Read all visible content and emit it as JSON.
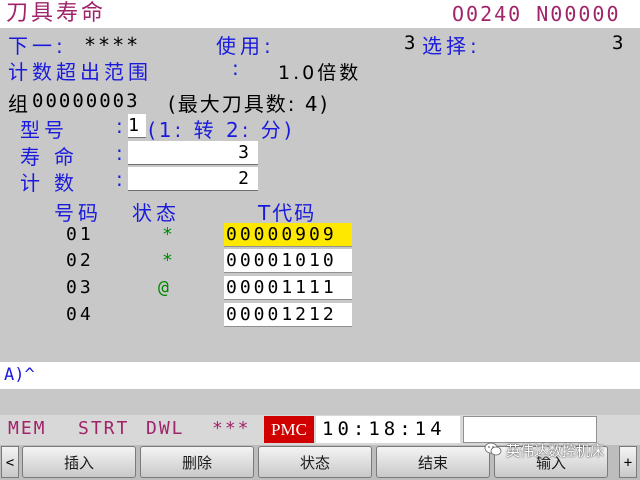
{
  "header": {
    "title": "刀具寿命",
    "program": "O0240 N00000"
  },
  "info": {
    "next_label": "下一:",
    "next_value": "****",
    "use_label": "使用:",
    "use_value": "3",
    "select_label": "选择:",
    "select_value": "3",
    "overflow_label": "计数超出范围",
    "overflow_colon": ":",
    "overflow_value": "1.0倍数"
  },
  "group": {
    "label": "组",
    "number": "00000003",
    "max_tools": "(最大刀具数:  4)"
  },
  "fields": {
    "type_label": "型号",
    "type_colon": ":",
    "type_value": "1",
    "type_hint": "(1: 转 2: 分)",
    "life_label": "寿命",
    "life_colon": ":",
    "life_value": "3",
    "count_label": "计数",
    "count_colon": ":",
    "count_value": "2"
  },
  "table": {
    "headers": {
      "num": "号码",
      "status": "状态",
      "tcode": "T代码"
    },
    "rows": [
      {
        "num": "01",
        "status": "*",
        "tcode": "00000909"
      },
      {
        "num": "02",
        "status": "*",
        "tcode": "00001010"
      },
      {
        "num": "03",
        "status": "@",
        "tcode": "00001111"
      },
      {
        "num": "04",
        "status": "",
        "tcode": "00001212"
      }
    ]
  },
  "input": {
    "prompt": "A)^"
  },
  "status": {
    "mode": "MEM",
    "run": "STRT",
    "motion": "DWL",
    "alarm": "***",
    "pmc": "PMC",
    "time": "10:18:14"
  },
  "softkeys": {
    "left_arrow": "<",
    "right_arrow": "+",
    "keys": [
      "插入",
      "删除",
      "状态",
      "结束",
      "输入"
    ]
  },
  "watermark": "英伟达数控机床",
  "colors": {
    "title": "#a0246a",
    "panel": "#c8c8c8",
    "blue": "#1a1adc",
    "highlight": "#ffe800",
    "pmc": "#d00000",
    "green": "#008800"
  }
}
